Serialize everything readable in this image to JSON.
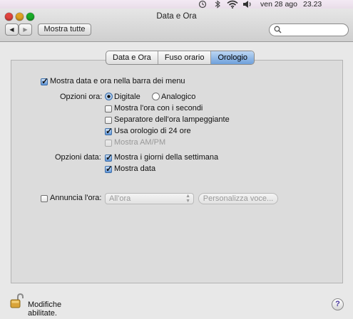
{
  "menubar": {
    "date": "ven 28 ago",
    "time": "23.23",
    "status_icons": [
      "time-machine-icon",
      "bluetooth-icon",
      "wifi-icon",
      "volume-icon"
    ]
  },
  "window": {
    "title": "Data e Ora",
    "back_label": "◀",
    "forward_label": "▶",
    "show_all_label": "Mostra tutte",
    "search_placeholder": ""
  },
  "tabs": [
    {
      "label": "Data e Ora",
      "active": false
    },
    {
      "label": "Fuso orario",
      "active": false
    },
    {
      "label": "Orologio",
      "active": true
    }
  ],
  "clock": {
    "show_in_menubar": {
      "label": "Mostra data e ora nella barra dei menu",
      "checked": true
    },
    "time_options_label": "Opzioni ora:",
    "digital_label": "Digitale",
    "analog_label": "Analogico",
    "selected_style": "Digitale",
    "show_seconds": {
      "label": "Mostra l'ora con i secondi",
      "checked": false
    },
    "flash_separators": {
      "label": "Separatore dell'ora lampeggiante",
      "checked": false
    },
    "use_24h": {
      "label": "Usa orologio di 24 ore",
      "checked": true
    },
    "show_ampm": {
      "label": "Mostra AM/PM",
      "checked": false,
      "enabled": false
    },
    "date_options_label": "Opzioni data:",
    "show_weekday": {
      "label": "Mostra i giorni della settimana",
      "checked": true
    },
    "show_date": {
      "label": "Mostra data",
      "checked": true
    },
    "announce": {
      "label": "Annuncia l'ora:",
      "checked": false
    },
    "announce_interval": "All'ora",
    "customize_voice_label": "Personalizza voce..."
  },
  "footer": {
    "lock_text": "Modifiche abilitate.",
    "help_label": "?"
  },
  "colors": {
    "accent_blue": "#5d93d6",
    "close": "#e0443e",
    "minimize": "#dea123",
    "zoom": "#1aab29"
  }
}
